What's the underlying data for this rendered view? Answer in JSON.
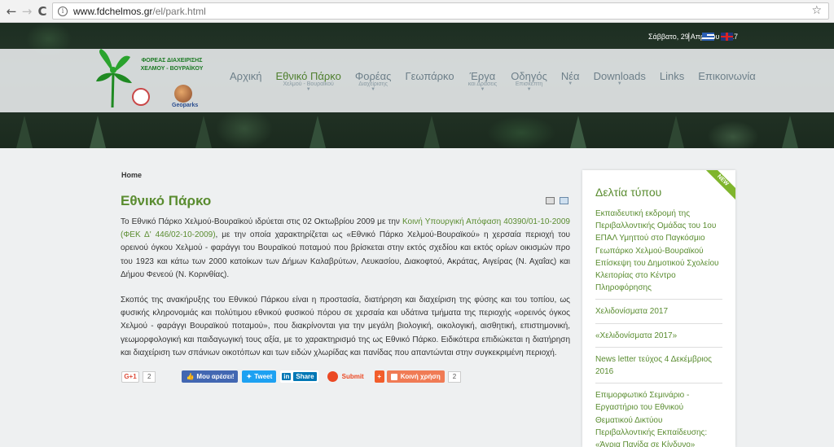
{
  "browser": {
    "url_host": "www.fdchelmos.gr",
    "url_path": "/el/park.html",
    "back_glyph": "←",
    "forward_glyph": "→",
    "reload_glyph": "C",
    "star_glyph": "☆",
    "info_glyph": "i"
  },
  "header": {
    "date": "Σάββατο, 29 Απριλίου 2017",
    "separator": "|",
    "logo_text": "ΦΟΡΕΑΣ ΔΙΑΧΕΙΡΙΣΗΣ ΧΕΛΜΟΥ - ΒΟΥΡΑΪΚΟΥ",
    "geoparks_label": "Geoparks"
  },
  "menu": [
    {
      "label": "Αρχική",
      "sub": "",
      "caret": ""
    },
    {
      "label": "Εθνικό Πάρκο",
      "sub": "Χελμού - Βουραϊκού",
      "caret": "▼"
    },
    {
      "label": "Φορέας",
      "sub": "Διαχείρισης",
      "caret": "▼"
    },
    {
      "label": "Γεωπάρκο",
      "sub": "",
      "caret": ""
    },
    {
      "label": "Έργα",
      "sub": "και Δράσεις",
      "caret": "▼"
    },
    {
      "label": "Οδηγός",
      "sub": "Επισκέπτη",
      "caret": "▼"
    },
    {
      "label": "Νέα",
      "sub": "",
      "caret": "▼"
    },
    {
      "label": "Downloads",
      "sub": "",
      "caret": "▼"
    },
    {
      "label": "Links",
      "sub": "",
      "caret": ""
    },
    {
      "label": "Επικοινωνία",
      "sub": "",
      "caret": ""
    }
  ],
  "breadcrumb": "Home",
  "article": {
    "title": "Εθνικό Πάρκο",
    "p1_before": "Το Εθνικό Πάρκο Χελμού-Βουραϊκού ιδρύεται στις 02 Οκτωβρίου 2009 με την ",
    "p1_link": "Κοινή Υπουργική Απόφαση 40390/01-10-2009 (ΦΕΚ Δ' 446/02-10-2009)",
    "p1_after": ", με την οποία χαρακτηρίζεται ως «Εθνικό Πάρκο Χελμού-Βουραϊκού» η χερσαία περιοχή του ορεινού όγκου Χελμού - φαράγγι του Βουραϊκού ποταμού που βρίσκεται στην εκτός σχεδίου και εκτός ορίων οικισμών προ του 1923 και κάτω των 2000 κατοίκων των Δήμων Καλαβρύτων, Λευκασίου, Διακοφτού, Ακράτας, Αιγείρας (Ν. Αχαΐας) και Δήμου Φενεού (Ν. Κορινθίας).",
    "p2": "Σκοπός της ανακήρυξης του Εθνικού Πάρκου είναι η προστασία, διατήρηση και διαχείριση της φύσης και του τοπίου, ως φυσικής κληρονομιάς και πολύτιμου εθνικού φυσικού πόρου σε χερσαία και υδάτινα τμήματα της περιοχής «ορεινός όγκος Χελμού - φαράγγι Βουραϊκού ποταμού», που διακρίνονται για την μεγάλη βιολογική, οικολογική, αισθητική, επιστημονική, γεωμορφολογική και παιδαγωγική τους αξία, με το χαρακτηρισμό της ως Εθνικό Πάρκο. Ειδικότερα επιδιώκεται η διατήρηση και διαχείριση των σπάνιων οικοτόπων και των ειδών χλωρίδας και πανίδας που απαντώνται στην συγκεκριμένη περιοχή."
  },
  "share": {
    "gplus_label": "G+1",
    "gplus_count": "2",
    "facebook_label": "Μου αρέσει!",
    "twitter_label": "Tweet",
    "linkedin_in": "in",
    "linkedin_label": "Share",
    "stumble_label": "Submit",
    "plus_label": "+",
    "share_label": "Κοινή χρήση",
    "share_count": "2"
  },
  "sidebar": {
    "ribbon": "NEW",
    "title": "Δελτία τύπου",
    "items": [
      "Εκπαιδευτική εκδρομή της Περιβαλλοντικής Ομάδας του 1ου ΕΠΑΛ Υμηττού στο Παγκόσμιο Γεωπάρκο Χελμού-Βουραϊκού Επίσκεψη του Δημοτικού Σχολείου Κλειτορίας στο Κέντρο Πληροφόρησης",
      "Χελιδονίσματα 2017",
      "«Χελιδονίσματα 2017»",
      "News letter τεύχος 4 Δεκέμβριος 2016",
      "Επιμορφωτικό Σεμινάριο - Εργαστήριο του Εθνικού Θεματικού Δικτύου Περιβαλλοντικής Εκπαίδευσης: «Άγρια Πανίδα σε Κίνδυνο»"
    ]
  },
  "colors": {
    "accent_green": "#5a8c30",
    "menu_text": "#6d7f89"
  }
}
